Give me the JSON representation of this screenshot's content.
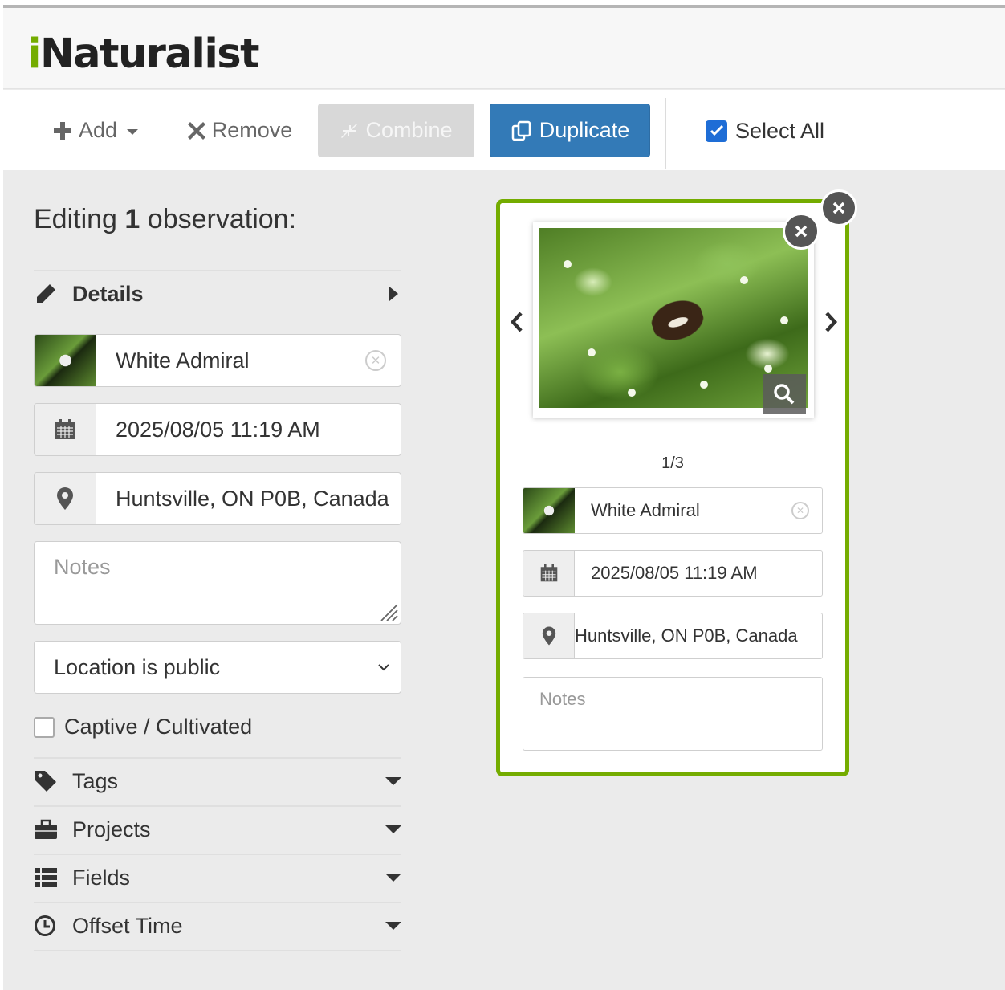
{
  "app": {
    "logo_i": "i",
    "logo_rest": "Naturalist"
  },
  "toolbar": {
    "add": "Add",
    "remove": "Remove",
    "combine": "Combine",
    "duplicate": "Duplicate",
    "select_all": "Select All",
    "select_all_checked": true
  },
  "editor": {
    "heading_prefix": "Editing",
    "heading_count": "1",
    "heading_suffix": "observation:",
    "details": "Details",
    "species": "White Admiral",
    "datetime": "2025/08/05 11:19 AM",
    "location": "Huntsville, ON P0B, Canada",
    "notes_placeholder": "Notes",
    "geoprivacy": "Location is public",
    "captive": "Captive / Cultivated",
    "captive_checked": false,
    "sections": {
      "tags": "Tags",
      "projects": "Projects",
      "fields": "Fields",
      "offset_time": "Offset Time"
    }
  },
  "card": {
    "photo_counter": "1/3",
    "species": "White Admiral",
    "datetime": "2025/08/05 11:19 AM",
    "location": "Huntsville, ON P0B, Canada",
    "notes_placeholder": "Notes"
  },
  "colors": {
    "accent": "#74ac00",
    "primary": "#337ab7",
    "checkbox": "#1e6dd6"
  }
}
